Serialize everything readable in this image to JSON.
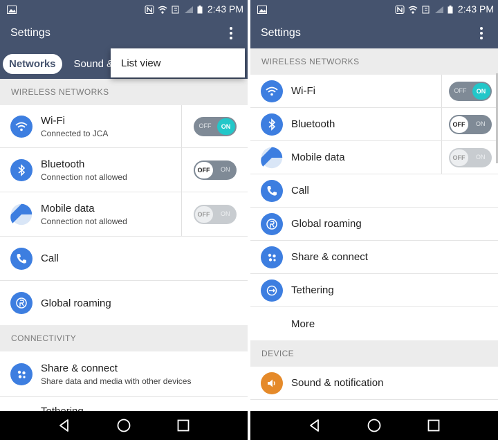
{
  "status": {
    "time": "2:43 PM"
  },
  "left": {
    "title": "Settings",
    "tabs": [
      {
        "label": "Networks",
        "active": true
      },
      {
        "label": "Sound & n",
        "active": false
      }
    ],
    "menu": {
      "item": "List view"
    },
    "sections": [
      {
        "header": "WIRELESS NETWORKS"
      },
      {
        "header": "CONNECTIVITY"
      }
    ],
    "items": [
      {
        "label": "Wi-Fi",
        "sub": "Connected to JCA",
        "icon": "wifi-icon",
        "toggle": "on"
      },
      {
        "label": "Bluetooth",
        "sub": "Connection not allowed",
        "icon": "bluetooth-icon",
        "toggle": "off"
      },
      {
        "label": "Mobile data",
        "sub": "Connection not allowed",
        "icon": "mobile-data-icon",
        "toggle": "disabled"
      },
      {
        "label": "Call",
        "sub": "",
        "icon": "phone-icon"
      },
      {
        "label": "Global roaming",
        "sub": "",
        "icon": "roaming-icon"
      },
      {
        "label": "Share & connect",
        "sub": "Share data and media with other devices",
        "icon": "share-icon"
      },
      {
        "label": "Tethering",
        "sub": "",
        "icon": "tethering-icon"
      }
    ]
  },
  "right": {
    "title": "Settings",
    "sections": [
      {
        "header": "WIRELESS NETWORKS"
      },
      {
        "header": "DEVICE"
      }
    ],
    "items": [
      {
        "label": "Wi-Fi",
        "icon": "wifi-icon",
        "toggle": "on"
      },
      {
        "label": "Bluetooth",
        "icon": "bluetooth-icon",
        "toggle": "off"
      },
      {
        "label": "Mobile data",
        "icon": "mobile-data-icon",
        "toggle": "disabled"
      },
      {
        "label": "Call",
        "icon": "phone-icon"
      },
      {
        "label": "Global roaming",
        "icon": "roaming-icon"
      },
      {
        "label": "Share & connect",
        "icon": "share-icon"
      },
      {
        "label": "Tethering",
        "icon": "tethering-icon"
      },
      {
        "label": "More",
        "icon": ""
      },
      {
        "label": "Sound & notification",
        "icon": "sound-icon"
      }
    ]
  },
  "toggle_text": {
    "on": "ON",
    "off": "OFF"
  },
  "colors": {
    "appbar": "#45536e",
    "icon_blue": "#3d7ee0",
    "icon_orange": "#e58a2a",
    "toggle_on": "#22c7c9",
    "section_bg": "#ececec"
  }
}
